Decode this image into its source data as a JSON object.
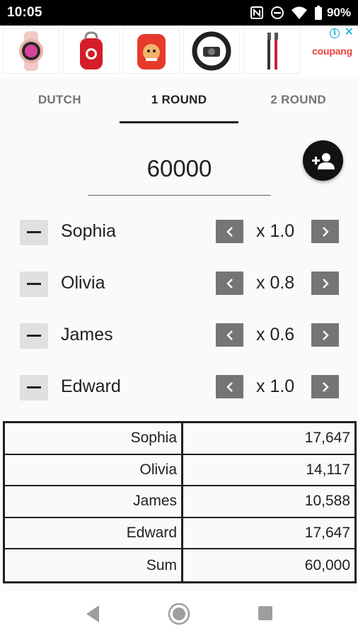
{
  "status_bar": {
    "time": "10:05",
    "battery_percent": "90%",
    "icons": [
      "nfc-icon",
      "do-not-disturb-icon",
      "wifi-icon",
      "battery-icon"
    ]
  },
  "ad": {
    "brand": "coupang",
    "items": [
      "smartwatch",
      "red-case",
      "cartoon-case",
      "steering-wheel",
      "cable"
    ]
  },
  "tabs": [
    {
      "label": "DUTCH",
      "active": false
    },
    {
      "label": "1 ROUND",
      "active": true
    },
    {
      "label": "2 ROUND",
      "active": false
    }
  ],
  "amount": {
    "value": "60000"
  },
  "people": [
    {
      "name": "Sophia",
      "multiplier": "x 1.0"
    },
    {
      "name": "Olivia",
      "multiplier": "x 0.8"
    },
    {
      "name": "James",
      "multiplier": "x 0.6"
    },
    {
      "name": "Edward",
      "multiplier": "x 1.0"
    }
  ],
  "results": [
    {
      "name": "Sophia",
      "value": "17,647"
    },
    {
      "name": "Olivia",
      "value": "14,117"
    },
    {
      "name": "James",
      "value": "10,588"
    },
    {
      "name": "Edward",
      "value": "17,647"
    },
    {
      "name": "Sum",
      "value": "60,000"
    }
  ],
  "colors": {
    "accent": "#212121",
    "fab": "#121212",
    "arrow_button": "#757575",
    "ad_brand": "#e8423b"
  }
}
